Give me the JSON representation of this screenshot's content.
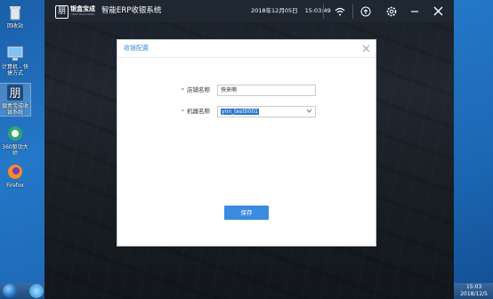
{
  "desktop": {
    "icons": [
      {
        "label": "回收站",
        "icon": "recycle-bin-icon"
      },
      {
        "label": "计算机 - 快捷方式",
        "icon": "computer-icon"
      },
      {
        "label": "银盒宝成收银系统",
        "icon": "erp-app-icon"
      },
      {
        "label": "360驱动大师",
        "icon": "driver-master-icon"
      },
      {
        "label": "Firefox",
        "icon": "firefox-icon"
      }
    ]
  },
  "taskbar": {
    "clock_time": "15:03",
    "clock_date": "2018/12/5"
  },
  "app": {
    "brand": "银盒宝成",
    "brand_sub": "YINHE BAOCHENG",
    "logo_glyph": "朋",
    "title": "智能ERP收银系统",
    "date": "2018年12月05日",
    "time": "15:03:49",
    "icons": {
      "wifi": "wifi-icon",
      "upload": "upload-icon",
      "settings": "gear-icon",
      "minimize": "minimize-icon",
      "close": "close-icon"
    }
  },
  "dialog": {
    "title": "收银配置",
    "store_name_label": "店铺名称",
    "store_name_value": "快来啊",
    "terminal_label": "机器名称",
    "terminal_value": "ynn_test0001",
    "required_mark": "*",
    "save_label": "保存"
  },
  "colors": {
    "accent": "#3b8be0",
    "title_accent": "#3f8ed8",
    "required": "#e05a3c",
    "app_titlebar": "#1e2732"
  }
}
